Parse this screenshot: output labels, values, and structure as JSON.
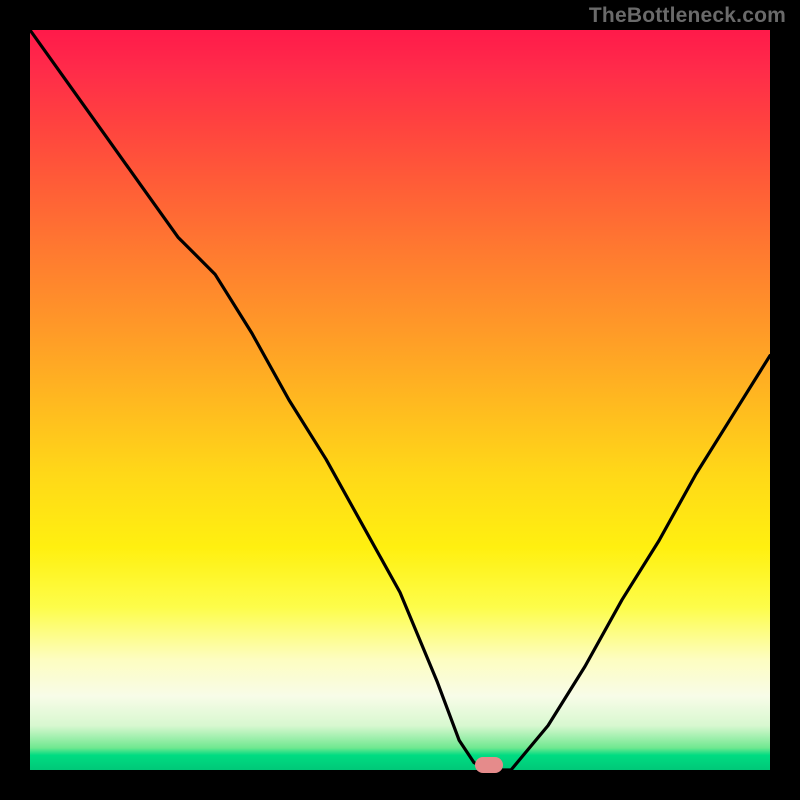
{
  "watermark": "TheBottleneck.com",
  "colors": {
    "background": "#000000",
    "curve_stroke": "#000000",
    "marker_fill": "#e58b8b",
    "gradient_top": "#ff1a4a",
    "gradient_bottom": "#00c878"
  },
  "chart_data": {
    "type": "line",
    "title": "",
    "xlabel": "",
    "ylabel": "",
    "xlim": [
      0,
      100
    ],
    "ylim": [
      0,
      100
    ],
    "annotations": [
      "gradient-background",
      "bottleneck-marker"
    ],
    "marker": {
      "x": 62,
      "y": 0
    },
    "series": [
      {
        "name": "bottleneck-curve",
        "x": [
          0,
          5,
          10,
          15,
          20,
          25,
          30,
          35,
          40,
          45,
          50,
          55,
          58,
          60,
          62,
          65,
          70,
          75,
          80,
          85,
          90,
          95,
          100
        ],
        "values": [
          100,
          93,
          86,
          79,
          72,
          67,
          59,
          50,
          42,
          33,
          24,
          12,
          4,
          1,
          0,
          0,
          6,
          14,
          23,
          31,
          40,
          48,
          56
        ]
      }
    ]
  }
}
